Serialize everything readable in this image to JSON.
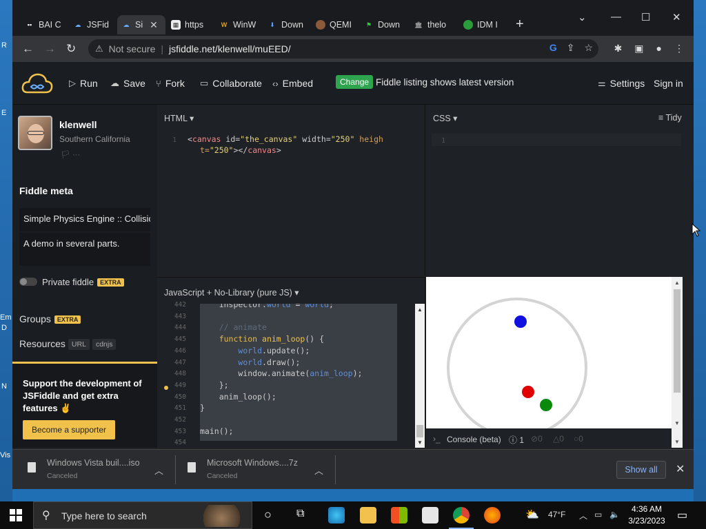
{
  "desktop": {
    "left_letters": [
      "R",
      "E",
      "Em",
      "D",
      "N",
      "Vis"
    ]
  },
  "tabs": [
    {
      "label": "BAI C",
      "icon": "bai-icon"
    },
    {
      "label": "JSFid",
      "icon": "jsfiddle-icon"
    },
    {
      "label": "Si",
      "icon": "jsfiddle-icon",
      "active": true
    },
    {
      "label": "https",
      "icon": "generic-page-icon"
    },
    {
      "label": "WinW",
      "icon": "winworld-icon"
    },
    {
      "label": "Down",
      "icon": "download-icon"
    },
    {
      "label": "QEMI",
      "icon": "qemu-icon"
    },
    {
      "label": "Down",
      "icon": "green-flag-icon"
    },
    {
      "label": "thelo",
      "icon": "building-icon"
    },
    {
      "label": "IDM I",
      "icon": "idm-icon"
    }
  ],
  "address": {
    "security": "Not secure",
    "url": "jsfiddle.net/klenwell/muEED/"
  },
  "header": {
    "run": "Run",
    "save": "Save",
    "fork": "Fork",
    "collaborate": "Collaborate",
    "embed": "Embed",
    "change": "Change",
    "listing": "Fiddle listing shows latest version",
    "settings": "Settings",
    "signin": "Sign in"
  },
  "user": {
    "name": "klenwell",
    "location": "Southern California",
    "icons": "🏳 ···"
  },
  "meta": {
    "heading": "Fiddle meta",
    "title": "Simple Physics Engine :: Collisio",
    "description": "A demo in several parts.",
    "private": "Private fiddle",
    "extra": "EXTRA",
    "groups": "Groups",
    "resources": "Resources",
    "url_chip": "URL",
    "cdnjs_chip": "cdnjs"
  },
  "support": {
    "text": "Support the development of JSFiddle and get extra features ✌",
    "button": "Become a supporter"
  },
  "panels": {
    "html_label": "HTML ▾",
    "css_label": "CSS ▾",
    "tidy": "Tidy",
    "js_label": "JavaScript + No-Library (pure JS) ▾"
  },
  "html_code": {
    "ln": "1",
    "l1a": "<",
    "l1tag": "canvas",
    "l1attr1": " id=",
    "l1val1": "\"the_canvas\"",
    "l1attr2": " width=",
    "l1val2": "\"250\"",
    "l1attr3": " heigh",
    "l2attr": "t=",
    "l2val": "\"250\"",
    "l2close": "></",
    "l2tag": "canvas",
    "l2end": ">"
  },
  "css_code": {
    "ln": "1"
  },
  "js_code": {
    "lines": [
      {
        "n": "442",
        "text": "    inspector.world = world;"
      },
      {
        "n": "443",
        "text": ""
      },
      {
        "n": "444",
        "text": "    // animate"
      },
      {
        "n": "445",
        "text": "    function anim_loop() {"
      },
      {
        "n": "446",
        "text": "        world.update();"
      },
      {
        "n": "447",
        "text": "        world.draw();"
      },
      {
        "n": "448",
        "text": "        window.animate(anim_loop);"
      },
      {
        "n": "449",
        "text": "    };"
      },
      {
        "n": "450",
        "text": "    anim_loop();"
      },
      {
        "n": "451",
        "text": "}"
      },
      {
        "n": "452",
        "text": ""
      },
      {
        "n": "453",
        "text": "main();"
      },
      {
        "n": "454",
        "text": ""
      }
    ]
  },
  "result": {
    "console": "Console (beta)",
    "console_count": "1",
    "c2": "0",
    "c3": "0",
    "c4": "0"
  },
  "downloads": [
    {
      "name": "Windows Vista buil....iso",
      "status": "Canceled"
    },
    {
      "name": "Microsoft Windows....7z",
      "status": "Canceled"
    }
  ],
  "downloads_bar": {
    "show_all": "Show all"
  },
  "taskbar": {
    "search_placeholder": "Type here to search",
    "temp": "47°F",
    "time": "4:36 AM",
    "date": "3/23/2023"
  },
  "colors": {
    "accent_yellow": "#f0c24b",
    "change_green": "#2ea44f",
    "ball_blue": "#1010e0",
    "ball_red": "#e00000",
    "ball_green": "#0a8a0a"
  }
}
